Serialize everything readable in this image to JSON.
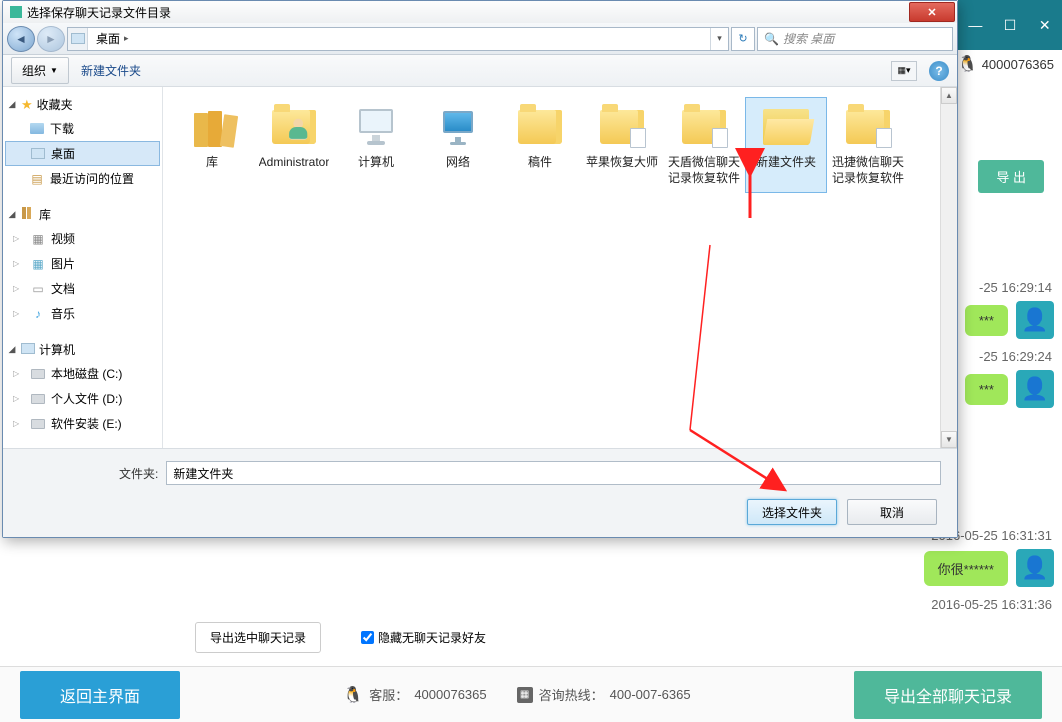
{
  "bg": {
    "phone": "4000076365",
    "export_btn": "导 出",
    "chat": [
      {
        "time": "-25 16:29:14",
        "text": "***"
      },
      {
        "time": "-25 16:29:24",
        "text": "***"
      },
      {
        "time": "2016-05-25 16:31:31",
        "text": "你很******"
      },
      {
        "time": "2016-05-25 16:31:36",
        "text": ""
      }
    ],
    "mid": {
      "export_selected": "导出选中聊天记录",
      "hide_empty": "隐藏无聊天记录好友"
    },
    "bottom": {
      "back": "返回主界面",
      "kefu_label": "客服：",
      "kefu_phone": "4000076365",
      "hotline_label": "咨询热线：",
      "hotline_phone": "400-007-6365",
      "export_all": "导出全部聊天记录"
    }
  },
  "dialog": {
    "title": "选择保存聊天记录文件目录",
    "breadcrumb": "桌面",
    "search_placeholder": "搜索 桌面",
    "toolbar": {
      "organize": "组织",
      "new_folder": "新建文件夹"
    },
    "tree": {
      "favorites": {
        "label": "收藏夹",
        "items": [
          "下载",
          "桌面",
          "最近访问的位置"
        ]
      },
      "libraries": {
        "label": "库",
        "items": [
          "视频",
          "图片",
          "文档",
          "音乐"
        ]
      },
      "computer": {
        "label": "计算机",
        "items": [
          "本地磁盘 (C:)",
          "个人文件 (D:)",
          "软件安装 (E:)"
        ]
      }
    },
    "items": [
      {
        "label": "库",
        "type": "lib"
      },
      {
        "label": "Administrator",
        "type": "user"
      },
      {
        "label": "计算机",
        "type": "comp"
      },
      {
        "label": "网络",
        "type": "net"
      },
      {
        "label": "稿件",
        "type": "folder"
      },
      {
        "label": "苹果恢复大师",
        "type": "folder-doc"
      },
      {
        "label": "天盾微信聊天记录恢复软件",
        "type": "folder-doc"
      },
      {
        "label": "新建文件夹",
        "type": "folder-open",
        "selected": true
      },
      {
        "label": "迅捷微信聊天记录恢复软件",
        "type": "folder-doc"
      }
    ],
    "footer": {
      "folder_label": "文件夹:",
      "folder_value": "新建文件夹",
      "select": "选择文件夹",
      "cancel": "取消"
    }
  }
}
